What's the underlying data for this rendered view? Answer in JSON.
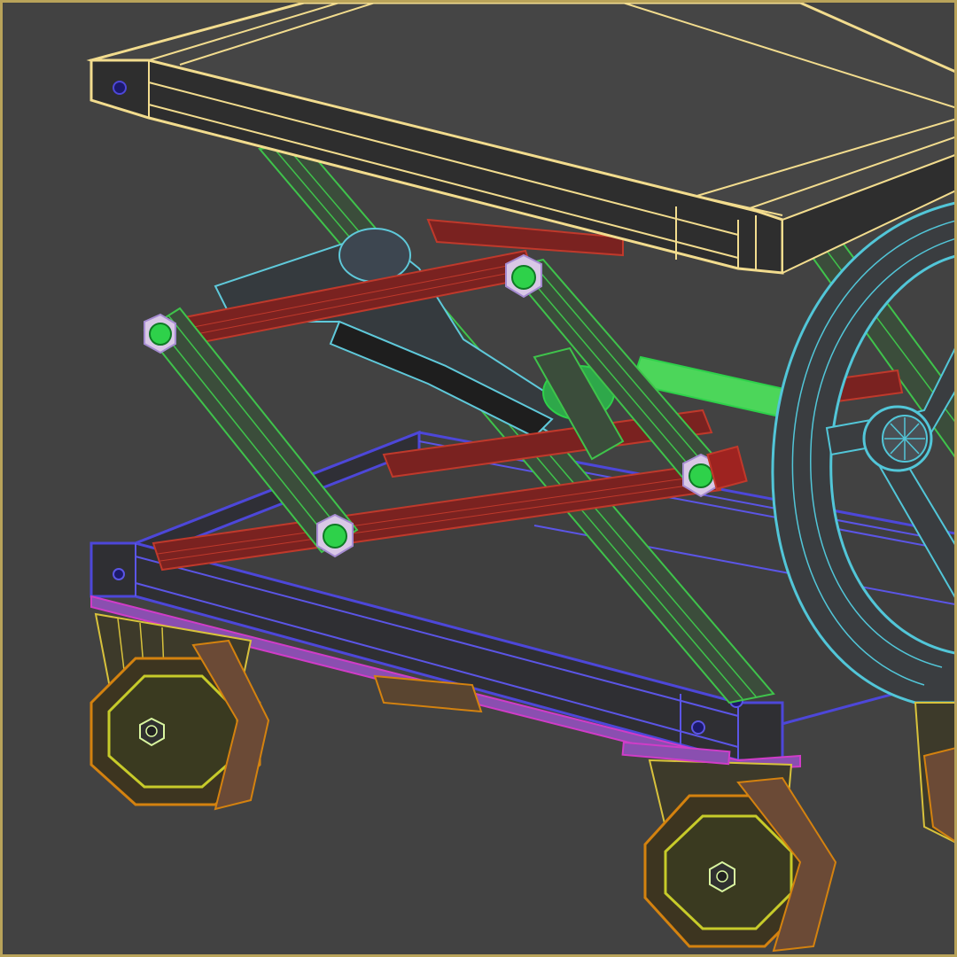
{
  "viewport": {
    "background": "#424242",
    "border_color": "#b9a35a"
  },
  "object_colors": {
    "platform_top": "#f2dc8e",
    "scissor_arms": "#3fc34b",
    "cross_bars": "#9e2320",
    "base_frame": "#4d47d9",
    "hand_wheel": "#52c6d8",
    "hydraulic_cylinder": "#5fc9da",
    "pivot_bolts": "#2ed14a",
    "caster_wheels": "#d4820f",
    "caster_forks": "#d8c23c",
    "mount_plates": "#d03cc8"
  },
  "icons": [
    "pivot-bolt-icon",
    "axle-nut-icon",
    "wheel-hub-icon"
  ]
}
